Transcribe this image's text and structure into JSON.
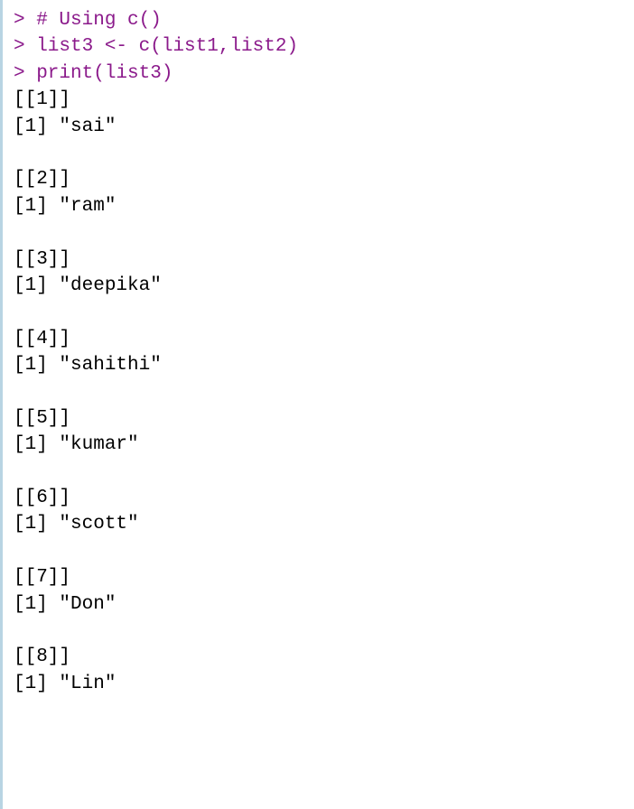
{
  "input": {
    "line1": "> # Using c()",
    "line2": "> list3 <- c(list1,list2)",
    "line3": "> print(list3)"
  },
  "output": {
    "items": [
      {
        "index": "[[1]]",
        "value": "[1] \"sai\""
      },
      {
        "index": "[[2]]",
        "value": "[1] \"ram\""
      },
      {
        "index": "[[3]]",
        "value": "[1] \"deepika\""
      },
      {
        "index": "[[4]]",
        "value": "[1] \"sahithi\""
      },
      {
        "index": "[[5]]",
        "value": "[1] \"kumar\""
      },
      {
        "index": "[[6]]",
        "value": "[1] \"scott\""
      },
      {
        "index": "[[7]]",
        "value": "[1] \"Don\""
      },
      {
        "index": "[[8]]",
        "value": "[1] \"Lin\""
      }
    ]
  }
}
